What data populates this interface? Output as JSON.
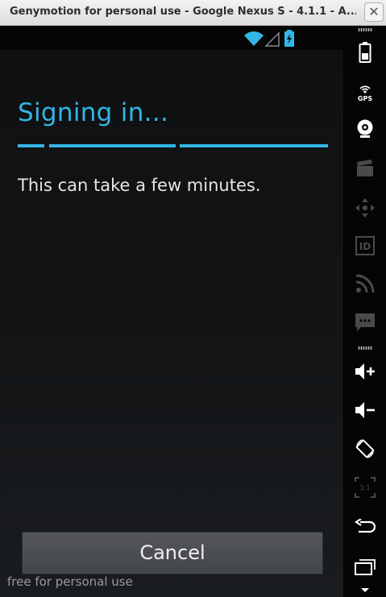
{
  "window": {
    "title": "Genymotion for personal use - Google Nexus S - 4.1.1 - A...",
    "close_glyph": "✕"
  },
  "screen": {
    "heading": "Signing in...",
    "message": "This can take a few minutes.",
    "cancel_label": "Cancel",
    "watermark": "free for personal use",
    "accent_color": "#33b5e5"
  },
  "status_bar": {
    "icons": [
      "wifi-icon",
      "cell-signal-icon",
      "battery-charging-icon"
    ]
  },
  "toolbar": {
    "items": [
      {
        "name": "battery-icon"
      },
      {
        "name": "gps-icon",
        "label": "GPS"
      },
      {
        "name": "camera-icon"
      },
      {
        "name": "screencast-icon"
      },
      {
        "name": "dpad-icon"
      },
      {
        "name": "device-id-icon",
        "label": "ID"
      },
      {
        "name": "network-icon"
      },
      {
        "name": "sms-icon"
      },
      {
        "name": "volume-up-icon"
      },
      {
        "name": "volume-down-icon"
      },
      {
        "name": "rotate-icon"
      },
      {
        "name": "scale-icon",
        "label": "1:1"
      },
      {
        "name": "back-icon"
      },
      {
        "name": "recent-apps-icon"
      }
    ]
  }
}
